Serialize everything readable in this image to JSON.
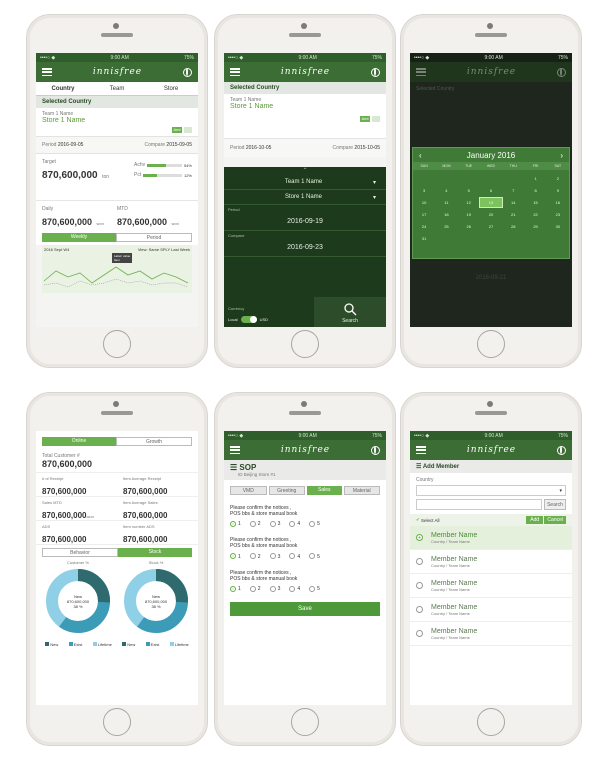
{
  "common": {
    "status_carrier": "••••○ ◆",
    "status_time": "9:00 AM",
    "status_battery": "75%",
    "brand": "innisfree"
  },
  "p1": {
    "tabs": [
      "Country",
      "Team",
      "Store"
    ],
    "section_title": "Selected Country",
    "team_label": "Team 1 Name",
    "store_label": "Store 1 Name",
    "toggle_on": "Amt",
    "period_label": "Period",
    "period_value": "2016-09-05",
    "compare_label": "Compare",
    "compare_value": "2015-09-05",
    "target_label": "Target",
    "target_value": "870,600,000",
    "target_unit": "ton",
    "achv_label": "Achv",
    "achv_pct": "54%",
    "pct_label": "Pct",
    "pct_value": "12%",
    "daily_label": "Daily",
    "daily_value": "870,600,000",
    "daily_unit": "won",
    "mtd_label": "MTD",
    "mtd_value": "870,600,000",
    "mtd_unit": "won",
    "seg_a": "Weekly",
    "seg_b": "Period",
    "chart_left": "2016 Sept W4",
    "chart_right": "View: Same SPLY   Last Week",
    "tooltip": "Label: value",
    "tooltip2": "Item"
  },
  "p2": {
    "section_title": "Selected Country",
    "team_label": "Team 1 Name",
    "store_label": "Store 1 Name",
    "toggle_on": "Amt",
    "period_label": "Period",
    "period_value": "2016-10-05",
    "compare_label": "Compare",
    "compare_value": "2015-10-05",
    "select1": "Team 1 Name",
    "select2": "Store 1 Name",
    "period_hdr": "Period",
    "date1": "2016-09-19",
    "compare_hdr": "Compare",
    "date2": "2016-09-23",
    "currency_label": "Currency",
    "local": "Local",
    "usd": "USD",
    "search": "Search"
  },
  "p3": {
    "month": "January 2016",
    "weekdays": [
      "SUN",
      "MON",
      "TUE",
      "WED",
      "THU",
      "FRI",
      "SAT"
    ],
    "days": [
      "",
      "",
      "",
      "",
      "",
      "1",
      "2",
      "3",
      "4",
      "5",
      "6",
      "7",
      "8",
      "9",
      "10",
      "11",
      "12",
      "13",
      "14",
      "15",
      "16",
      "17",
      "18",
      "19",
      "20",
      "21",
      "22",
      "23",
      "24",
      "25",
      "26",
      "27",
      "28",
      "29",
      "30",
      "31"
    ],
    "selected_day": "13",
    "bg_section": "Selected Country",
    "bg_date": "2016-09-21"
  },
  "p4": {
    "seg_a": "Online",
    "seg_b": "Growth",
    "total_label": "Total Customer #",
    "total_value": "870,600,000",
    "items": [
      {
        "label": "# of Receipt",
        "value": "870,600,000"
      },
      {
        "label": "Item Average Receipt",
        "value": "870,600,000"
      },
      {
        "label": "Sales MTD",
        "value": "870,600,000",
        "unit": "won"
      },
      {
        "label": "Item Average Sales",
        "value": "870,600,000"
      },
      {
        "label": "ADS",
        "value": "870,600,000"
      },
      {
        "label": "Item number ADS",
        "value": "870,600,000"
      }
    ],
    "seg2_a": "Behavior",
    "seg2_b": "Stock",
    "donut1_title": "Customer %",
    "donut2_title": "Stock %",
    "donut_center": "New",
    "donut_center_value": "870,600,000",
    "donut_center_pct": "38 %",
    "legend": [
      "New",
      "Exist",
      "Lifetime"
    ],
    "colors": {
      "dark": "#2f6b6e",
      "mid": "#3c9bb6",
      "light": "#8fd0e6"
    }
  },
  "p5": {
    "title": "SOP",
    "subtitle": "ID Beijing Store #1",
    "tabs": [
      "VMD",
      "Greeting",
      "Sales",
      "Material"
    ],
    "question_line1": "Please confirm the notices ,",
    "question_line2": "POS bbs & store manual book",
    "options": [
      "1",
      "2",
      "3",
      "4",
      "5"
    ],
    "save": "Save"
  },
  "p6": {
    "title": "Add Member",
    "country_label": "Country",
    "search_btn": "Search",
    "select_all": "Select All",
    "add_btn": "Add",
    "cancel_btn": "Cancel",
    "members": [
      {
        "name": "Member Name",
        "sub": "Country / Team Name",
        "selected": true
      },
      {
        "name": "Member Name",
        "sub": "Country / Team Name",
        "selected": false
      },
      {
        "name": "Member Name",
        "sub": "Country / Team Name",
        "selected": false
      },
      {
        "name": "Member Name",
        "sub": "Country / Team Name",
        "selected": false
      },
      {
        "name": "Member Name",
        "sub": "Country / Team Name",
        "selected": false
      }
    ]
  }
}
